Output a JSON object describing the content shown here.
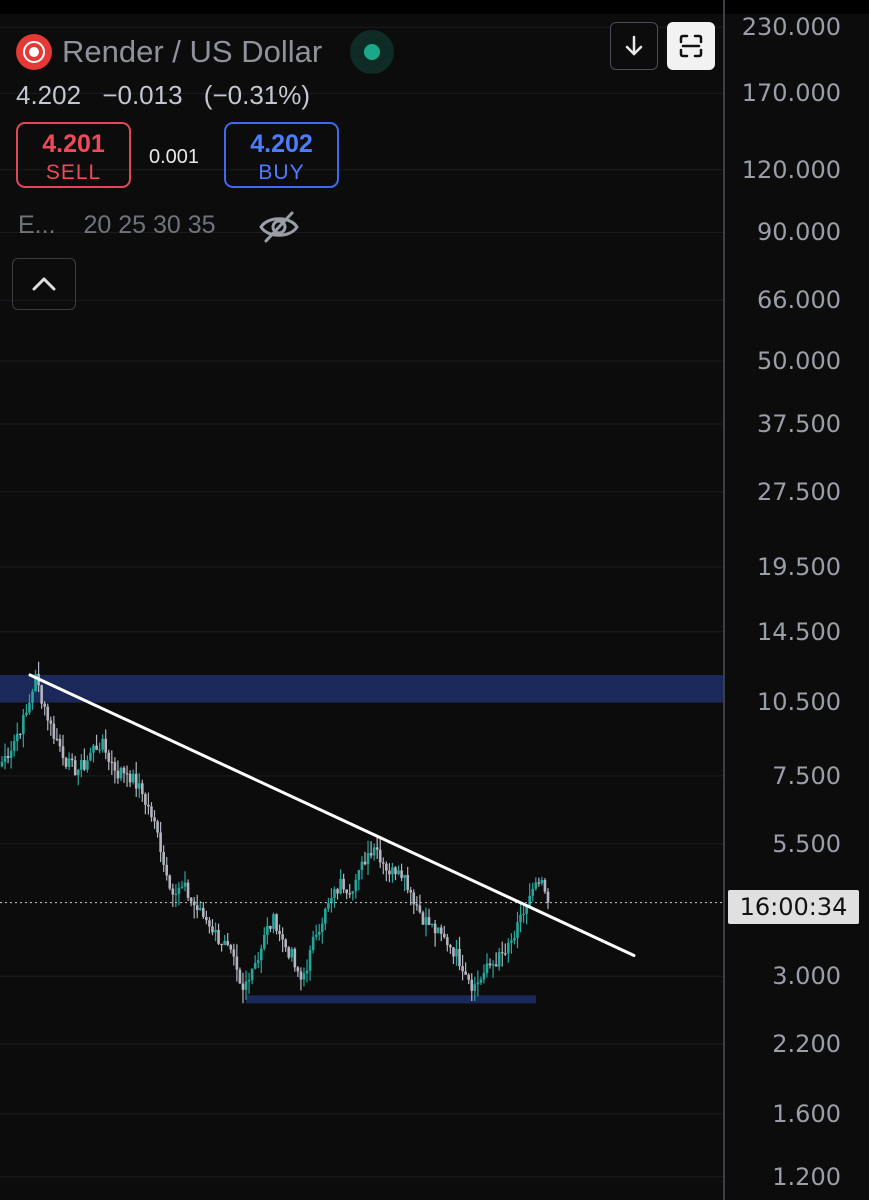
{
  "header": {
    "title": "Render / US Dollar",
    "last_price": "4.202",
    "change": "−0.013",
    "change_pct": "(−0.31%)"
  },
  "trade": {
    "sell_price": "4.201",
    "sell_label": "SELL",
    "spread": "0.001",
    "buy_price": "4.202",
    "buy_label": "BUY"
  },
  "indicators": {
    "name": "E...",
    "periods": "20 25 30 35"
  },
  "icons": {
    "symbol": "render-logo-icon",
    "status": "market-status-dot-icon",
    "visibility": "eye-off-icon",
    "collapse": "chevron-up-icon",
    "scroll": "arrow-down-icon",
    "fullscreen": "fullscreen-icon"
  },
  "colors": {
    "background": "#0c0c0d",
    "up_candle": "#26a69a",
    "down_candle": "#b2b5be",
    "zone": "#1b2b5e",
    "trendline": "#ffffff",
    "sell": "#f04a5a",
    "buy": "#4d7dff"
  },
  "price_axis": {
    "scale": "log",
    "ticks": [
      "230.000",
      "170.000",
      "120.000",
      "90.000",
      "66.000",
      "50.000",
      "37.500",
      "27.500",
      "19.500",
      "14.500",
      "10.500",
      "7.500",
      "5.500",
      "3.000",
      "2.200",
      "1.600",
      "1.200"
    ],
    "countdown": "16:00:34"
  },
  "chart_data": {
    "type": "candlestick",
    "y_scale": "log",
    "ylim": [
      1.15,
      240
    ],
    "current_price": 4.202,
    "series_close": [
      8.0,
      8.5,
      9.2,
      10.0,
      11.8,
      10.5,
      9.3,
      8.6,
      7.9,
      7.7,
      7.9,
      8.5,
      8.7,
      8.1,
      7.6,
      7.7,
      7.3,
      6.9,
      6.3,
      5.6,
      4.7,
      4.4,
      4.5,
      4.2,
      4.0,
      3.85,
      3.6,
      3.45,
      3.2,
      2.75,
      3.1,
      3.3,
      3.7,
      3.9,
      3.5,
      3.3,
      2.9,
      3.2,
      3.7,
      4.0,
      4.3,
      4.6,
      4.5,
      4.7,
      5.2,
      5.5,
      5.1,
      4.8,
      5.0,
      4.6,
      4.2,
      3.9,
      3.75,
      3.6,
      3.5,
      3.3,
      3.1,
      2.85,
      3.0,
      3.15,
      3.25,
      3.35,
      3.6,
      4.0,
      4.35,
      4.6,
      4.25
    ],
    "resistance_zone": [
      10.5,
      11.9
    ],
    "support_zone": [
      2.65,
      2.75
    ],
    "trendline": [
      {
        "from": 11.9
      },
      {
        "to": 3.3
      }
    ]
  }
}
